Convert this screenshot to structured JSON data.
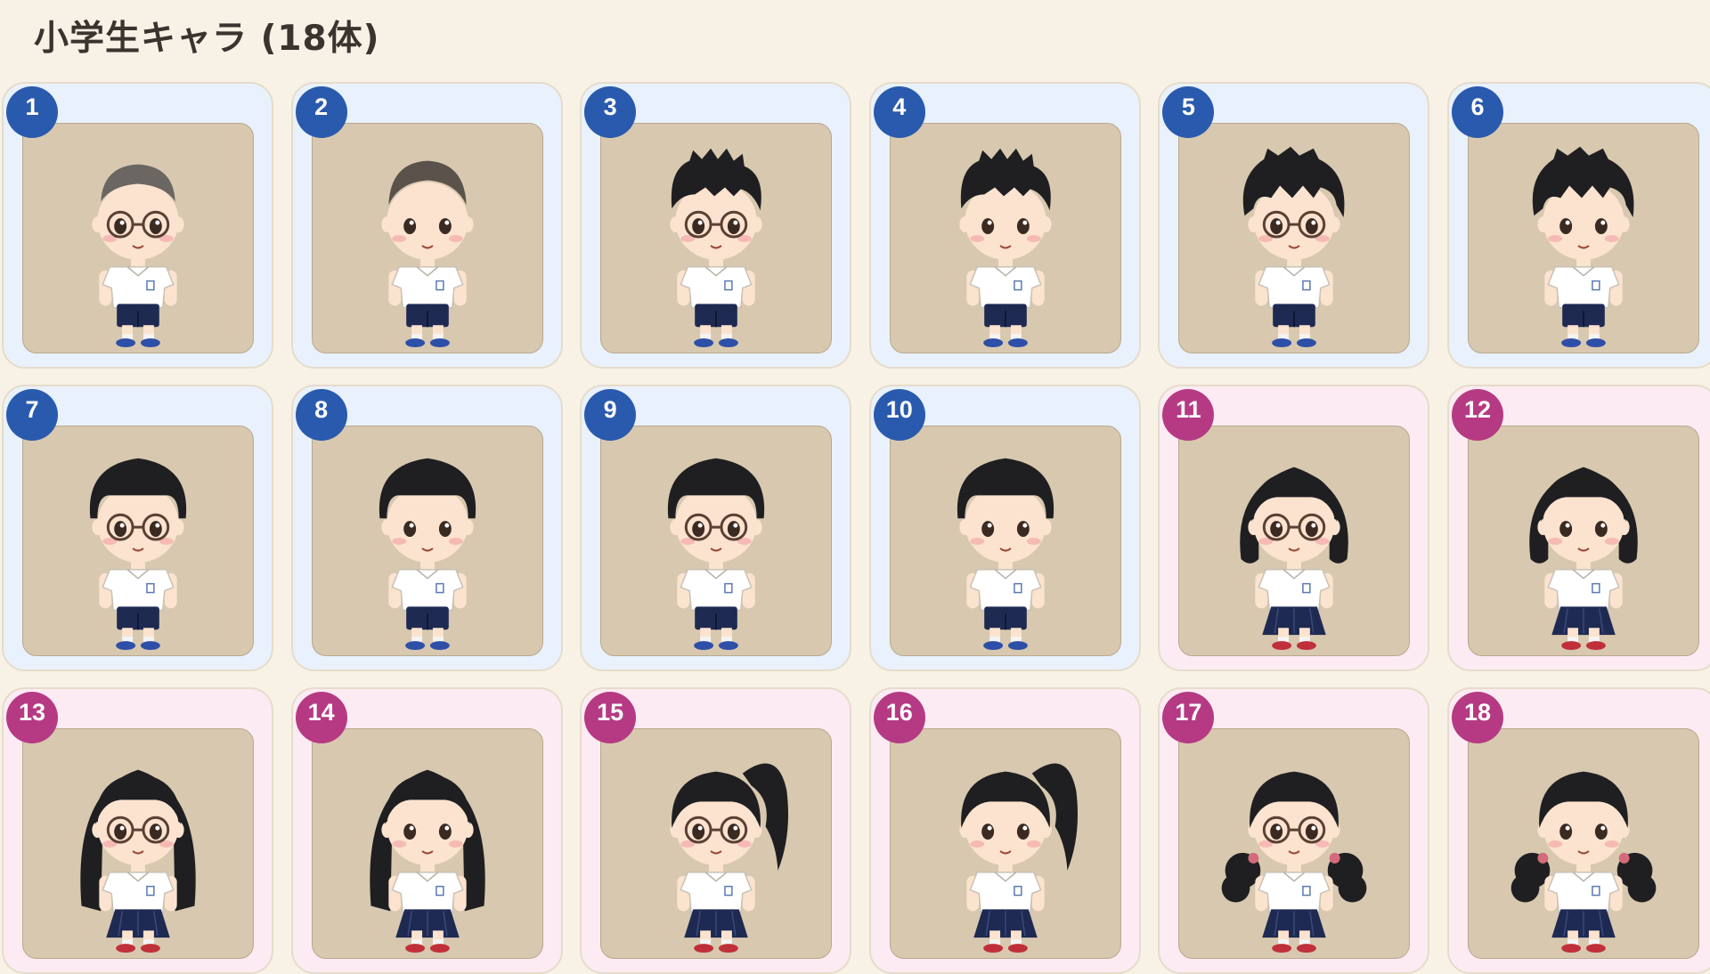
{
  "page": {
    "title": "小学生キャラ (18体)"
  },
  "colors": {
    "background": "#f8f2e6",
    "boy_card": "#e9f1fd",
    "girl_card": "#fdebf3",
    "boy_badge": "#2a5aad",
    "girl_badge": "#b53a83",
    "portrait_bg": "#d7c8af"
  },
  "characters": [
    {
      "number": "1",
      "gender": "boy",
      "hair": "buzz-gray",
      "glasses": true
    },
    {
      "number": "2",
      "gender": "boy",
      "hair": "buzz",
      "glasses": false
    },
    {
      "number": "3",
      "gender": "boy",
      "hair": "spiky",
      "glasses": true
    },
    {
      "number": "4",
      "gender": "boy",
      "hair": "spiky",
      "glasses": false
    },
    {
      "number": "5",
      "gender": "boy",
      "hair": "messy",
      "glasses": true
    },
    {
      "number": "6",
      "gender": "boy",
      "hair": "messy",
      "glasses": false
    },
    {
      "number": "7",
      "gender": "boy",
      "hair": "bowl",
      "glasses": true
    },
    {
      "number": "8",
      "gender": "boy",
      "hair": "bowl",
      "glasses": false
    },
    {
      "number": "9",
      "gender": "boy",
      "hair": "bowl",
      "glasses": true
    },
    {
      "number": "10",
      "gender": "boy",
      "hair": "bowl",
      "glasses": false
    },
    {
      "number": "11",
      "gender": "girl",
      "hair": "bob",
      "glasses": true
    },
    {
      "number": "12",
      "gender": "girl",
      "hair": "bob",
      "glasses": false
    },
    {
      "number": "13",
      "gender": "girl",
      "hair": "long",
      "glasses": true
    },
    {
      "number": "14",
      "gender": "girl",
      "hair": "long",
      "glasses": false
    },
    {
      "number": "15",
      "gender": "girl",
      "hair": "ponytail",
      "glasses": true
    },
    {
      "number": "16",
      "gender": "girl",
      "hair": "ponytail",
      "glasses": false
    },
    {
      "number": "17",
      "gender": "girl",
      "hair": "twintails",
      "glasses": true
    },
    {
      "number": "18",
      "gender": "girl",
      "hair": "twintails",
      "glasses": false
    }
  ]
}
